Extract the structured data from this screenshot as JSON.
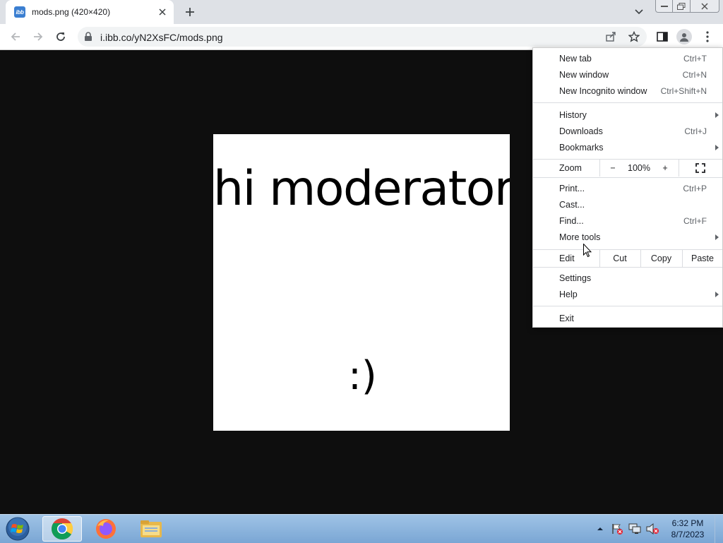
{
  "browser": {
    "tab": {
      "title": "mods.png (420×420)",
      "favicon_text": "ibb"
    },
    "url": "i.ibb.co/yN2XsFC/mods.png",
    "icons": {
      "back": "back-arrow-icon",
      "forward": "forward-arrow-icon",
      "reload": "reload-icon",
      "lock": "lock-icon",
      "share": "share-icon",
      "bookmark": "star-icon",
      "side_panel": "side-panel-icon",
      "profile": "profile-icon",
      "menu": "kebab-menu-icon"
    }
  },
  "image": {
    "line1": "hi moderators",
    "line2": ":)"
  },
  "menu": {
    "items": [
      {
        "label": "New tab",
        "shortcut": "Ctrl+T"
      },
      {
        "label": "New window",
        "shortcut": "Ctrl+N"
      },
      {
        "label": "New Incognito window",
        "shortcut": "Ctrl+Shift+N"
      },
      {
        "label": "History",
        "shortcut": ""
      },
      {
        "label": "Downloads",
        "shortcut": "Ctrl+J"
      },
      {
        "label": "Bookmarks",
        "shortcut": ""
      },
      {
        "label": "Print...",
        "shortcut": "Ctrl+P"
      },
      {
        "label": "Cast...",
        "shortcut": ""
      },
      {
        "label": "Find...",
        "shortcut": "Ctrl+F"
      },
      {
        "label": "More tools",
        "shortcut": ""
      },
      {
        "label": "Settings",
        "shortcut": ""
      },
      {
        "label": "Help",
        "shortcut": ""
      },
      {
        "label": "Exit",
        "shortcut": ""
      }
    ],
    "zoom": {
      "label": "Zoom",
      "minus": "−",
      "value": "100%",
      "plus": "+"
    },
    "edit": {
      "label": "Edit",
      "cut": "Cut",
      "copy": "Copy",
      "paste": "Paste"
    }
  },
  "taskbar": {
    "apps": [
      "chrome-icon",
      "firefox-icon",
      "file-explorer-icon"
    ],
    "time": "6:32 PM",
    "date": "8/7/2023"
  },
  "colors": {
    "tabstrip": "#dee1e6",
    "viewport": "#0e0e0e",
    "taskbar": "#8db5de"
  }
}
